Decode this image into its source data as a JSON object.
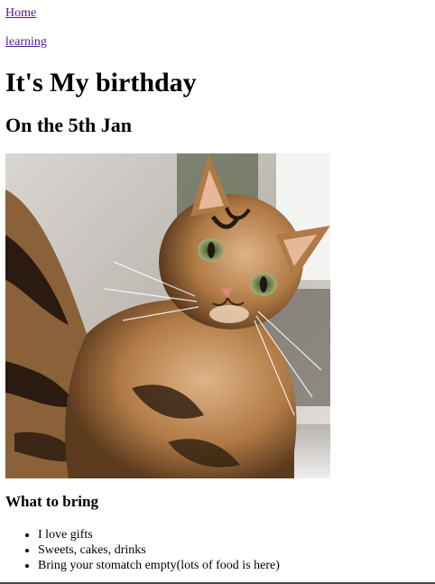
{
  "nav": {
    "home_label": "Home",
    "learning_label": "learning"
  },
  "main": {
    "title": "It's My birthday",
    "subtitle": "On the 5th Jan",
    "image": {
      "icon": "cat-selfie-photo"
    },
    "bring_heading": "What to bring",
    "bring_items": [
      "I love gifts",
      "Sweets, cakes, drinks",
      "Bring your stomatch empty(lots of food is here)"
    ]
  },
  "colors": {
    "link": "#551a8b",
    "text": "#000000",
    "background": "#ffffff"
  }
}
